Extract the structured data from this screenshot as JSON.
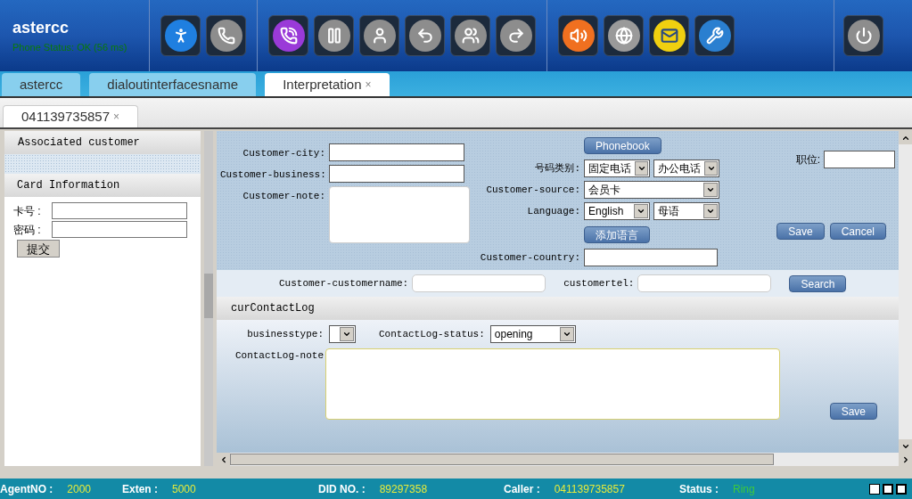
{
  "header": {
    "title": "astercc",
    "phone_status": "Phone Status: OK (56 ms)"
  },
  "tabs": [
    {
      "label": "astercc",
      "selected": false,
      "closable": false
    },
    {
      "label": "dialoutinterfacesname",
      "selected": false,
      "closable": false
    },
    {
      "label": "Interpretation",
      "selected": true,
      "closable": true
    }
  ],
  "close_mark": "×",
  "sub_tabs": [
    {
      "label": "041139735857",
      "selected": true,
      "closable": true
    }
  ],
  "left_panel": {
    "sections": [
      "Associated customer",
      "Card Information"
    ],
    "fields": [
      {
        "label": "卡号 :"
      },
      {
        "label": "密码 :"
      }
    ],
    "submit": "提交"
  },
  "customer_form": {
    "left_fields": [
      {
        "kind": "input",
        "label": "Customer-city:"
      },
      {
        "kind": "input",
        "label": "Customer-business:"
      },
      {
        "kind": "textarea",
        "label": "Customer-note:"
      }
    ],
    "phonebook_button": "Phonebook",
    "middle_rows": [
      {
        "label": "号码类别:",
        "selects": [
          {
            "value": "固定电话"
          },
          {
            "value": "办公电话"
          }
        ]
      },
      {
        "label": "Customer-source:",
        "selects": [
          {
            "value": "会员卡"
          }
        ]
      },
      {
        "label": "Language:",
        "selects": [
          {
            "value": "English"
          },
          {
            "value": "母语"
          }
        ]
      }
    ],
    "add_language_button": "添加语言",
    "country_label": "Customer-country:",
    "position_label": "职位:",
    "save_button": "Save",
    "cancel_button": "Cancel"
  },
  "search_bar": {
    "fields": [
      {
        "label": "Customer-customername:"
      },
      {
        "label": "customertel:"
      }
    ],
    "button": "Search"
  },
  "contact_log": {
    "title": "curContactLog",
    "businesstype_label": "businesstype:",
    "status_label": "ContactLog-status:",
    "status_value": "opening",
    "note_label": "ContactLog-note",
    "save_button": "Save"
  },
  "status_bar": [
    {
      "label": "AgentNO :",
      "value": "2000",
      "color": "#e6ea3c"
    },
    {
      "label": "Exten :",
      "value": "5000",
      "color": "#e6ea3c"
    },
    {
      "label": "DID NO. :",
      "value": "89297358",
      "color": "#e6ea3c"
    },
    {
      "label": "Caller :",
      "value": "041139735857",
      "color": "#e6ea3c"
    },
    {
      "label": "Status :",
      "value": "Ring",
      "color": "#3ec83e"
    }
  ]
}
